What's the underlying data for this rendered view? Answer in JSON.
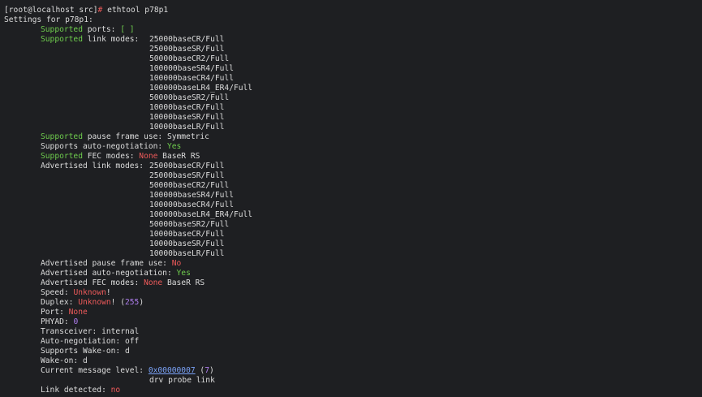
{
  "terminal": {
    "prompt": "[root@localhost src]",
    "prompt_symbol": "#",
    "command": "ethtool p78p1",
    "settings_header": "Settings for p78p1:",
    "supported_ports": {
      "label_green": "Supported",
      "label_rest": " ports: ",
      "value": "[ ]"
    },
    "supported_link_modes": {
      "label_green": "Supported",
      "label_rest": " link modes:",
      "modes": [
        "25000baseCR/Full",
        "25000baseSR/Full",
        "50000baseCR2/Full",
        "100000baseSR4/Full",
        "100000baseCR4/Full",
        "100000baseLR4_ER4/Full",
        "50000baseSR2/Full",
        "10000baseCR/Full",
        "10000baseSR/Full",
        "10000baseLR/Full"
      ]
    },
    "supported_pause": {
      "label_green": "Supported",
      "label_rest": " pause frame use: ",
      "value": "Symmetric"
    },
    "supports_autoneg": {
      "label": "Supports auto-negotiation: ",
      "value": "Yes"
    },
    "supported_fec": {
      "label_green": "Supported",
      "label_rest": " FEC modes: ",
      "value_red": "None",
      "value_rest": " BaseR RS"
    },
    "advertised_link_modes": {
      "label": "Advertised link modes:",
      "modes": [
        "25000baseCR/Full",
        "25000baseSR/Full",
        "50000baseCR2/Full",
        "100000baseSR4/Full",
        "100000baseCR4/Full",
        "100000baseLR4_ER4/Full",
        "50000baseSR2/Full",
        "10000baseCR/Full",
        "10000baseSR/Full",
        "10000baseLR/Full"
      ]
    },
    "advertised_pause": {
      "label": "Advertised pause frame use: ",
      "value": "No"
    },
    "advertised_autoneg": {
      "label": "Advertised auto-negotiation: ",
      "value": "Yes"
    },
    "advertised_fec": {
      "label": "Advertised FEC modes: ",
      "value_red": "None",
      "value_rest": " BaseR RS"
    },
    "speed": {
      "label": "Speed: ",
      "value": "Unknown",
      "suffix": "!"
    },
    "duplex": {
      "label": "Duplex: ",
      "value": "Unknown",
      "suffix": "! (",
      "number": "255",
      "close": ")"
    },
    "port": {
      "label": "Port: ",
      "value": "None"
    },
    "phyad": {
      "label": "PHYAD: ",
      "value": "0"
    },
    "transceiver": {
      "label": "Transceiver: ",
      "value": "internal"
    },
    "autoneg": {
      "label": "Auto-negotiation: ",
      "value": "off"
    },
    "supports_wake": {
      "label": "Supports Wake-on: ",
      "value": "d"
    },
    "wake_on": {
      "label": "Wake-on: ",
      "value": "d"
    },
    "msg_level": {
      "label": "Current message level: ",
      "hex": "0x00000007",
      "open": " (",
      "number": "7",
      "close": ")",
      "flags": "drv probe link"
    },
    "link_detected": {
      "label": "Link detected: ",
      "value": "no"
    },
    "colors": {
      "background": "#1e1f22",
      "text": "#dcdcdc",
      "green": "#6ecc4d",
      "red": "#ee5a5a",
      "purple": "#b07ef0",
      "blue": "#7aa2f7"
    }
  }
}
